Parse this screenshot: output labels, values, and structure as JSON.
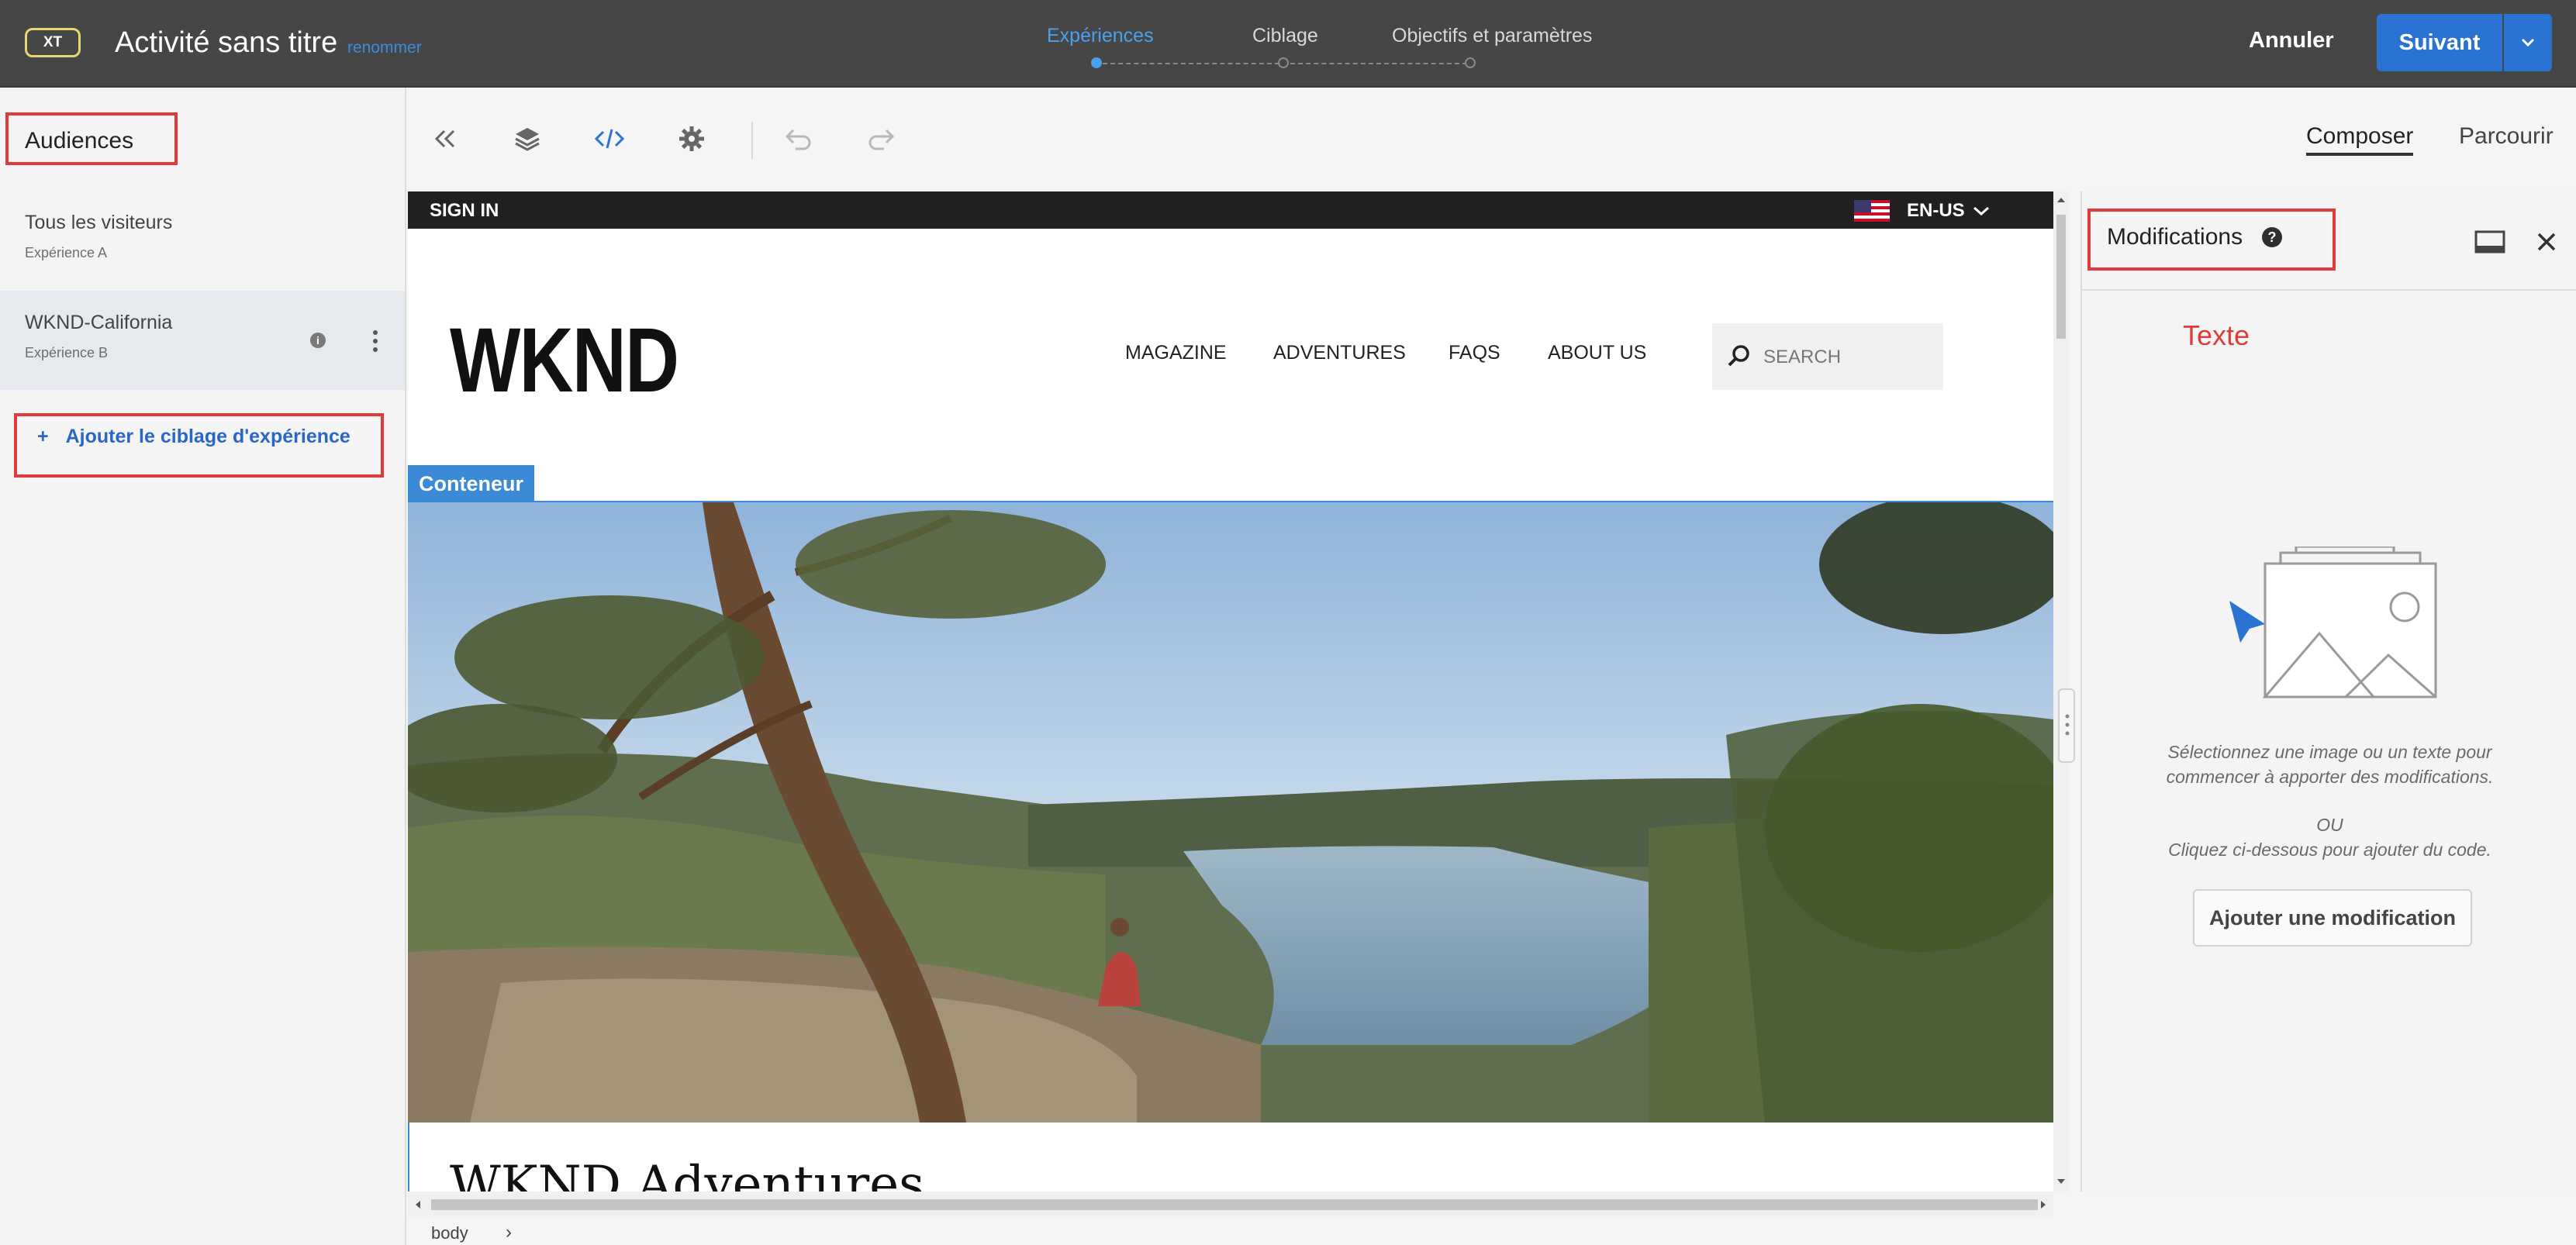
{
  "header": {
    "badge": "XT",
    "activity_title": "Activité sans titre",
    "rename_link": "renommer",
    "steps": [
      {
        "label": "Expériences",
        "active": true
      },
      {
        "label": "Ciblage",
        "active": false
      },
      {
        "label": "Objectifs et paramètres",
        "active": false
      }
    ],
    "cancel_label": "Annuler",
    "next_label": "Suivant"
  },
  "left_panel": {
    "title": "Audiences",
    "audiences": [
      {
        "name": "Tous les visiteurs",
        "experience": "Expérience A",
        "selected": false
      },
      {
        "name": "WKND-California",
        "experience": "Expérience B",
        "selected": true
      }
    ],
    "add_targeting_plus": "+",
    "add_targeting_label": "Ajouter le ciblage d'expérience"
  },
  "toolbar": {
    "icons": [
      "collapse-left-icon",
      "layers-icon",
      "code-icon",
      "settings-icon",
      "undo-icon",
      "redo-icon"
    ],
    "modes": [
      {
        "label": "Composer",
        "active": true
      },
      {
        "label": "Parcourir",
        "active": false
      }
    ]
  },
  "site": {
    "sign_in": "SIGN IN",
    "language": "EN-US",
    "logo": "WKND",
    "nav": [
      "MAGAZINE",
      "ADVENTURES",
      "FAQS",
      "ABOUT US"
    ],
    "search_placeholder": "SEARCH",
    "container_tag": "Conteneur",
    "hero_heading": "WKND Adventures"
  },
  "breadcrumb": {
    "path": "body",
    "chevron": "›"
  },
  "right_panel": {
    "title": "Modifications",
    "help": "?",
    "annotation": "Texte",
    "message_line1": "Sélectionnez une image ou un texte pour",
    "message_line2": "commencer à apporter des modifications.",
    "or": "OU",
    "message_line3": "Cliquez ci-dessous pour ajouter du code.",
    "add_button": "Ajouter une modification"
  },
  "colors": {
    "top_bar": "#464646",
    "accent_blue": "#2b73d2",
    "active_step": "#4aa0f0",
    "highlight_red": "#e03b3b",
    "container_blue": "#3a8ad8"
  }
}
